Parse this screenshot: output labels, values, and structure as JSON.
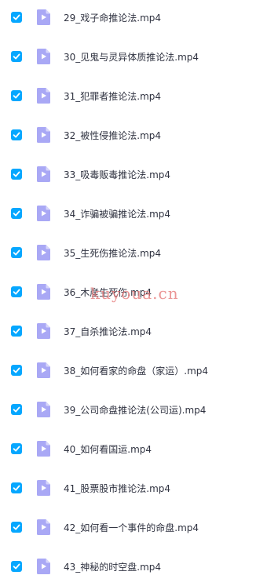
{
  "colors": {
    "accent": "#06a7ff",
    "icon_fill": "#a9a8f5",
    "icon_fold": "#d7d6fb",
    "text": "#2f3240",
    "watermark": "rgba(230,120,120,0.78)"
  },
  "files": [
    {
      "name": "29_戏子命推论法.mp4",
      "checked": true,
      "icon": "video-file-icon"
    },
    {
      "name": "30_见鬼与灵异体质推论法.mp4",
      "checked": true,
      "icon": "video-file-icon"
    },
    {
      "name": "31_犯罪者推论法.mp4",
      "checked": true,
      "icon": "video-file-icon"
    },
    {
      "name": "32_被性侵推论法.mp4",
      "checked": true,
      "icon": "video-file-icon"
    },
    {
      "name": "33_吸毒贩毒推论法.mp4",
      "checked": true,
      "icon": "video-file-icon"
    },
    {
      "name": "34_诈骗被骗推论法.mp4",
      "checked": true,
      "icon": "video-file-icon"
    },
    {
      "name": "35_生死伤推论法.mp4",
      "checked": true,
      "icon": "video-file-icon"
    },
    {
      "name": "36_木産生死伤.mp4",
      "checked": true,
      "icon": "video-file-icon"
    },
    {
      "name": "37_自杀推论法.mp4",
      "checked": true,
      "icon": "video-file-icon"
    },
    {
      "name": "38_如何看家的命盘（家运）.mp4",
      "checked": true,
      "icon": "video-file-icon"
    },
    {
      "name": "39_公司命盘推论法(公司运).mp4",
      "checked": true,
      "icon": "video-file-icon"
    },
    {
      "name": "40_如何看国运.mp4",
      "checked": true,
      "icon": "video-file-icon"
    },
    {
      "name": "41_股票股市推论法.mp4",
      "checked": true,
      "icon": "video-file-icon"
    },
    {
      "name": "42_如何看一个事件的命盘.mp4",
      "checked": true,
      "icon": "video-file-icon"
    },
    {
      "name": "43_神秘的时空盘.mp4",
      "checked": true,
      "icon": "video-file-icon"
    }
  ],
  "watermark": "kuyoua.cn"
}
